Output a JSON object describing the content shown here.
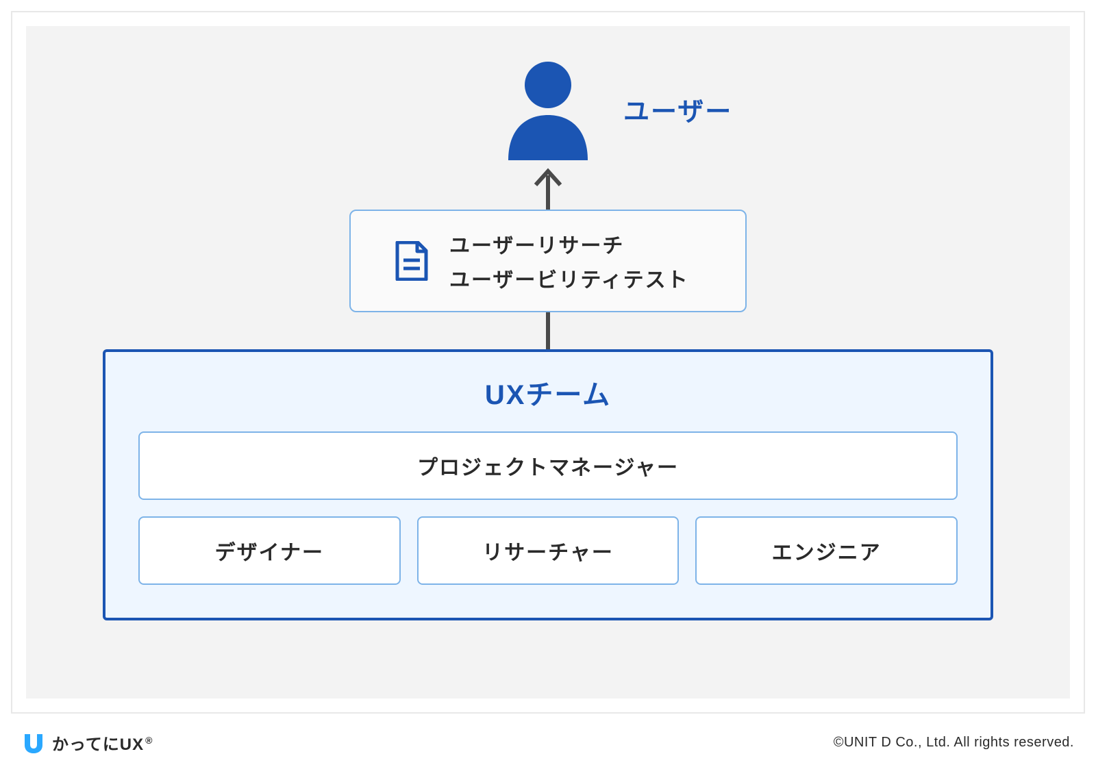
{
  "user": {
    "label": "ユーザー"
  },
  "research": {
    "line1": "ユーザーリサーチ",
    "line2": "ユーザービリティテスト"
  },
  "team": {
    "title": "UXチーム",
    "pm": "プロジェクトマネージャー",
    "roles": [
      "デザイナー",
      "リサーチャー",
      "エンジニア"
    ]
  },
  "footer": {
    "brand": "かってにUX",
    "reg": "®",
    "copyright": "©UNIT D Co., Ltd. All rights reserved."
  },
  "colors": {
    "primary": "#1b55b3",
    "border_light": "#7db3e8",
    "team_bg": "#eef6ff",
    "arrow": "#4a4a4a"
  }
}
